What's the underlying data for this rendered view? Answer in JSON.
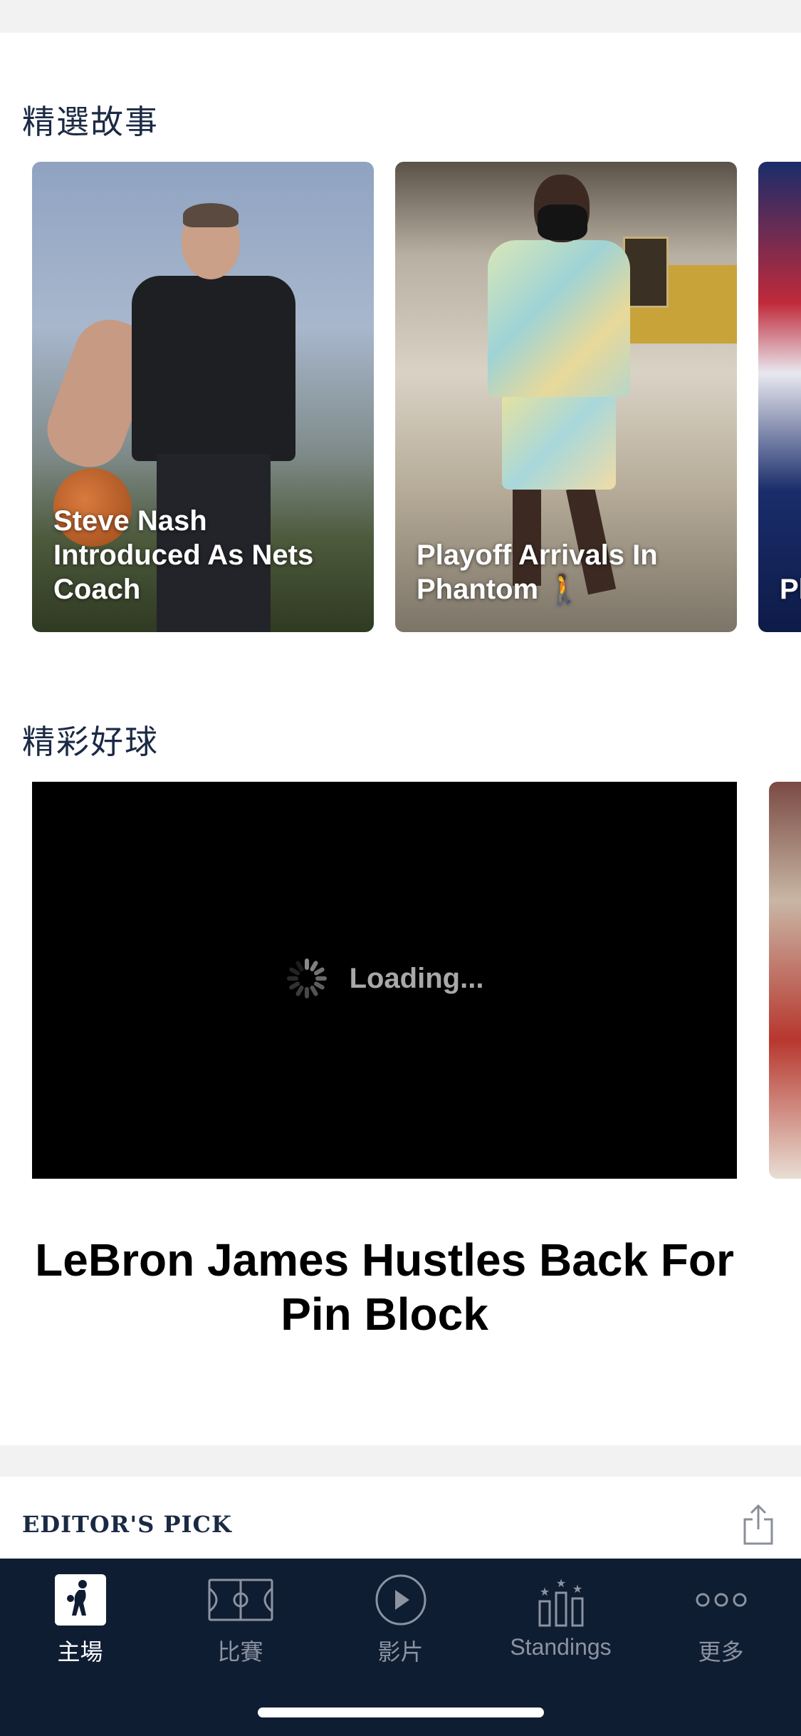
{
  "featured": {
    "section_title": "精選故事",
    "cards": [
      {
        "caption": "Steve Nash Introduced As Nets Coach"
      },
      {
        "caption": "Playoff Arrivals In Phantom 🚶"
      },
      {
        "caption": "Pl"
      }
    ]
  },
  "highlights": {
    "section_title": "精彩好球",
    "loading_text": "Loading...",
    "video_title": "LeBron James Hustles Back For Pin Block"
  },
  "editors_pick": {
    "title": "EDITOR'S PICK"
  },
  "tabbar": {
    "items": [
      {
        "label": "主場",
        "icon": "nba-logo-icon",
        "active": true
      },
      {
        "label": "比賽",
        "icon": "court-icon",
        "active": false
      },
      {
        "label": "影片",
        "icon": "play-circle-icon",
        "active": false
      },
      {
        "label": "Standings",
        "icon": "standings-icon",
        "active": false
      },
      {
        "label": "更多",
        "icon": "more-dots-icon",
        "active": false
      }
    ]
  },
  "colors": {
    "tabbar_bg": "#0f1d33",
    "title_text": "#1b2a44",
    "inactive_tab": "#8c93a1"
  }
}
